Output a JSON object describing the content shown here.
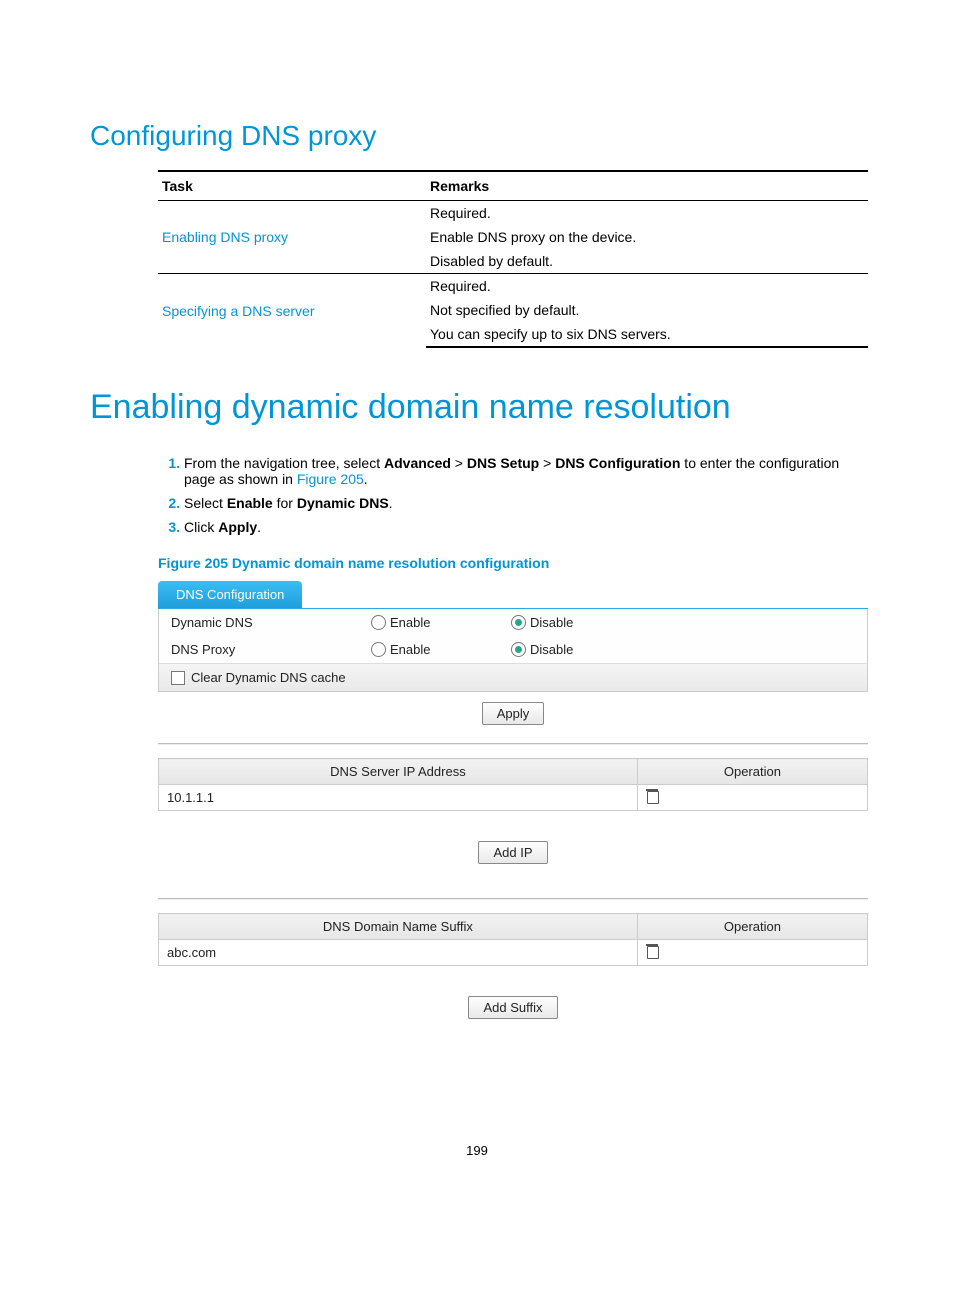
{
  "section1_title": "Configuring DNS proxy",
  "remarks_table": {
    "headers": [
      "Task",
      "Remarks"
    ],
    "rows": [
      {
        "task": "Enabling DNS proxy",
        "remarks": [
          "Required.",
          "Enable DNS proxy on the device.",
          "Disabled by default."
        ]
      },
      {
        "task": "Specifying a DNS server",
        "remarks": [
          "Required.",
          "Not specified by default.",
          "You can specify up to six DNS servers."
        ]
      }
    ]
  },
  "section2_title": "Enabling dynamic domain name resolution",
  "steps": {
    "s1_a": "From the navigation tree, select ",
    "s1_b1": "Advanced",
    "s1_gt": " > ",
    "s1_b2": "DNS Setup",
    "s1_b3": "DNS Configuration",
    "s1_c": " to enter the configuration page as shown in ",
    "s1_link": "Figure 205",
    "s1_d": ".",
    "s2_a": "Select ",
    "s2_b1": "Enable",
    "s2_mid": " for ",
    "s2_b2": "Dynamic DNS",
    "s2_end": ".",
    "s3_a": "Click ",
    "s3_b": "Apply",
    "s3_end": "."
  },
  "figure_caption": "Figure 205 Dynamic domain name resolution configuration",
  "panel": {
    "tab": "DNS Configuration",
    "rows": [
      {
        "label": "Dynamic DNS",
        "enable": "Enable",
        "disable": "Disable",
        "selected": "disable"
      },
      {
        "label": "DNS Proxy",
        "enable": "Enable",
        "disable": "Disable",
        "selected": "disable"
      }
    ],
    "clear_cache": "Clear Dynamic DNS cache",
    "apply": "Apply",
    "server_table": {
      "h1": "DNS Server IP Address",
      "h2": "Operation",
      "row": "10.1.1.1"
    },
    "add_ip": "Add IP",
    "suffix_table": {
      "h1": "DNS Domain Name Suffix",
      "h2": "Operation",
      "row": "abc.com"
    },
    "add_suffix": "Add Suffix"
  },
  "page_number": "199"
}
